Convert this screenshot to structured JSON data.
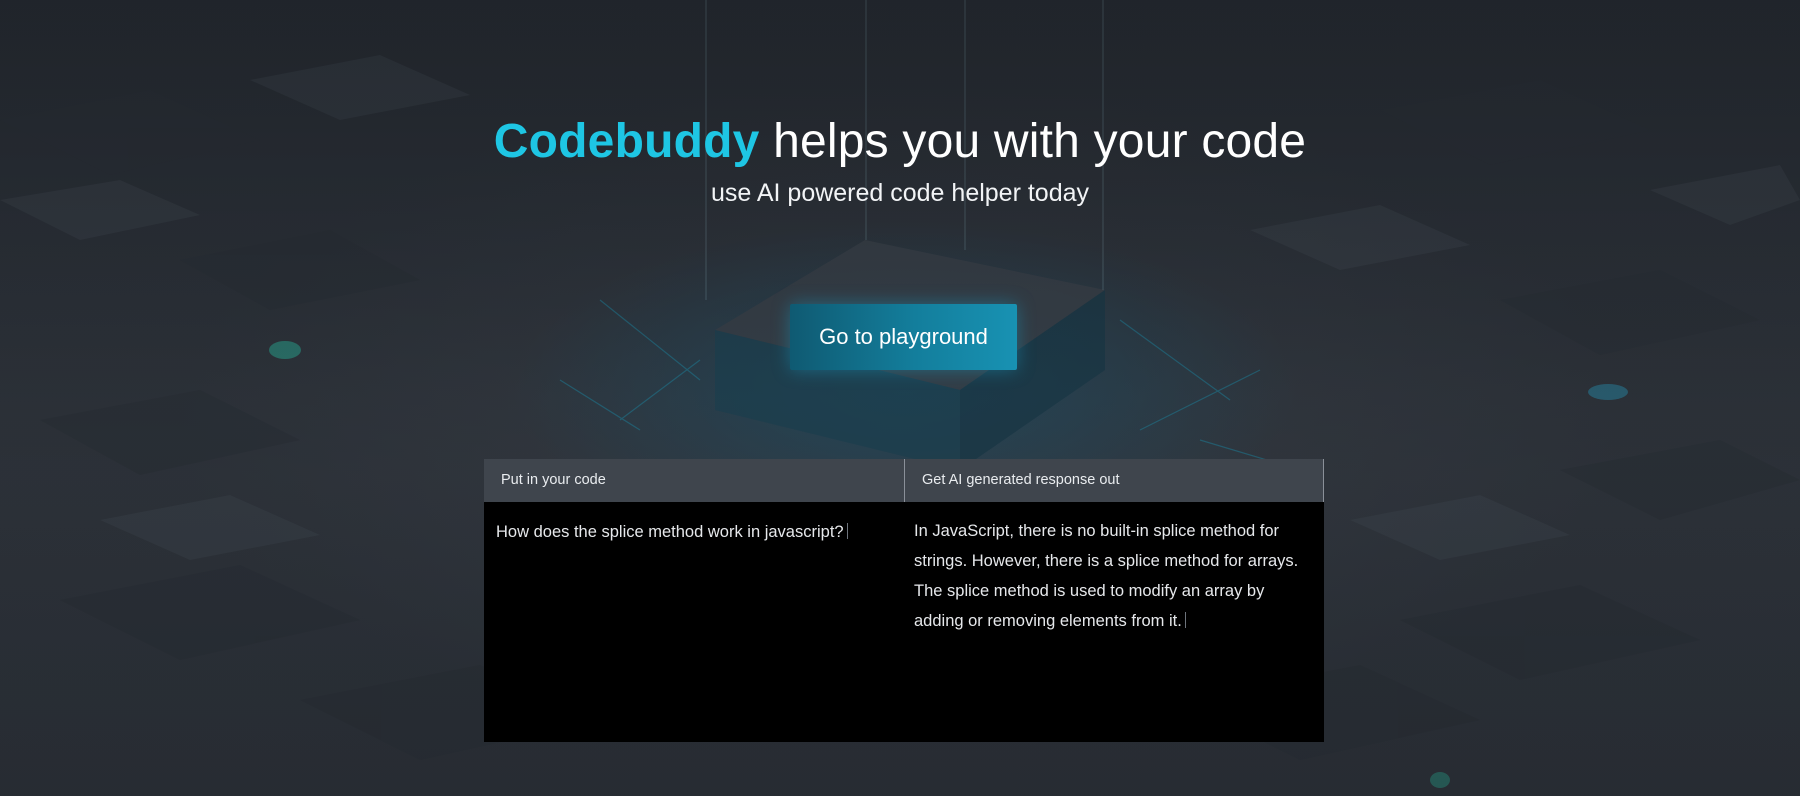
{
  "hero": {
    "brand": "Codebuddy",
    "headline_rest": " helps you with your code",
    "subtitle": "use AI powered code helper today"
  },
  "cta": {
    "label": "Go to playground"
  },
  "demo": {
    "input_header": "Put in your code",
    "output_header": "Get AI generated response out",
    "input_text": "How does the splice method work in javascript?",
    "output_text": "In JavaScript, there is no built-in splice method for strings. However, there is a splice method for arrays. The splice method is used to modify an array by adding or removing elements from it."
  },
  "theme": {
    "brand_color": "#1ec6e4",
    "button_color": "#137e9c",
    "panel_header_color": "#3f454d",
    "panel_body_color": "#000000"
  }
}
